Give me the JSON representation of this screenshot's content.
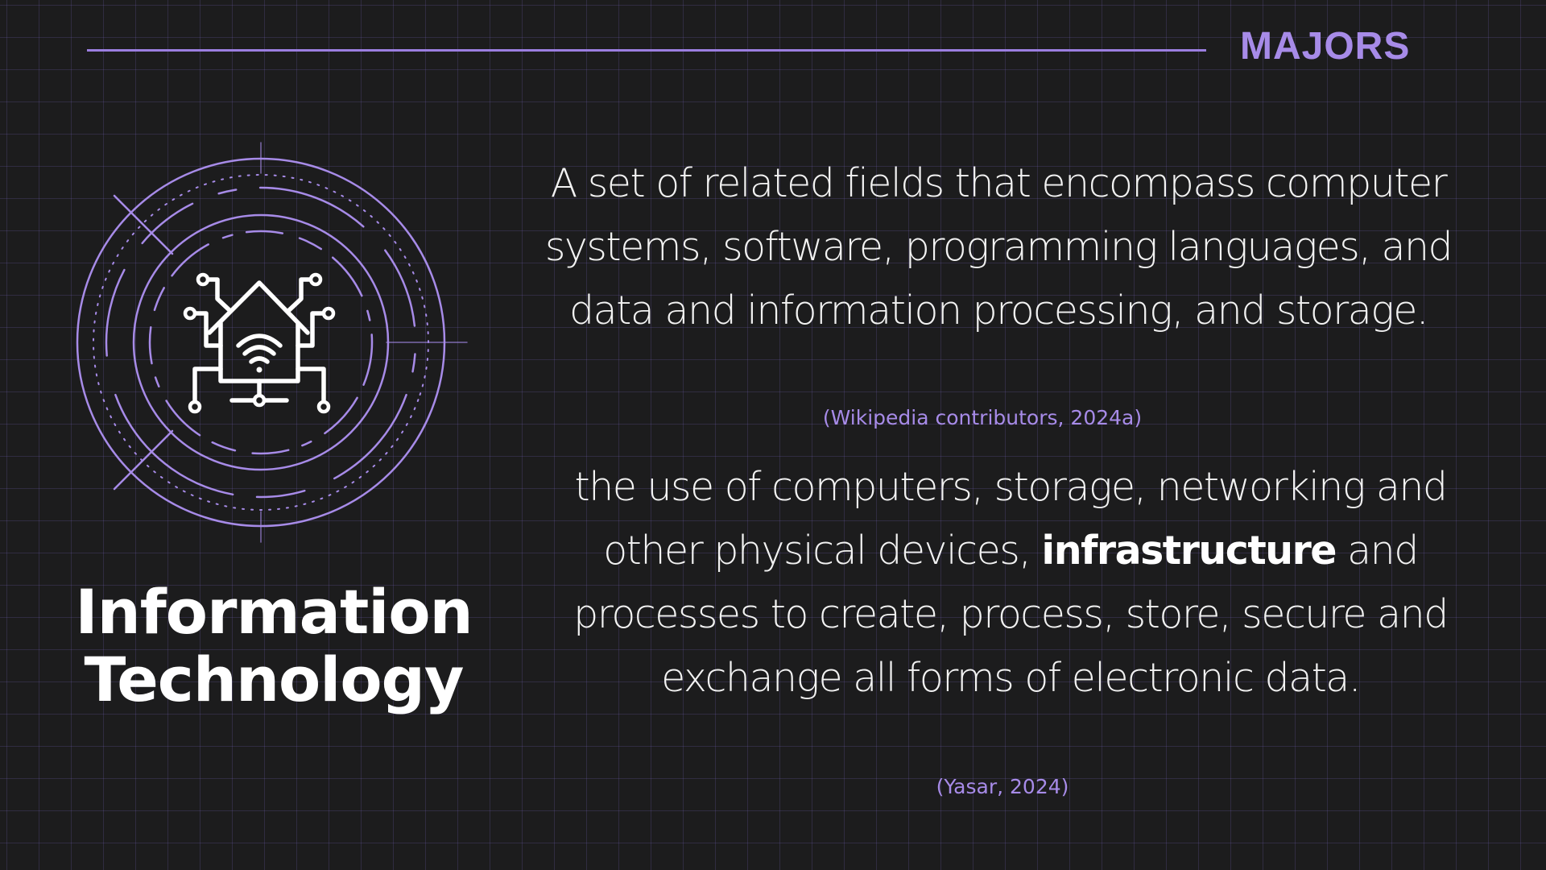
{
  "header": {
    "brand": "MAJORS"
  },
  "major": {
    "title_line_1": "Information",
    "title_line_2": "Technology",
    "icon": "smart-home-network-icon"
  },
  "definitions": [
    {
      "text": "A set of related fields that encompass computer systems, software, programming languages, and data and information processing, and storage.",
      "citation": "(Wikipedia contributors, 2024a)"
    },
    {
      "text_before": "the use of computers, storage, networking and other physical devices, ",
      "emphasis": "infrastructure",
      "text_after": " and processes to create, process, store, secure and exchange all forms of electronic data.",
      "citation": "(Yasar, 2024)"
    }
  ],
  "colors": {
    "background": "#1c1c1d",
    "accent": "#a78be8",
    "text": "#ffffff"
  }
}
